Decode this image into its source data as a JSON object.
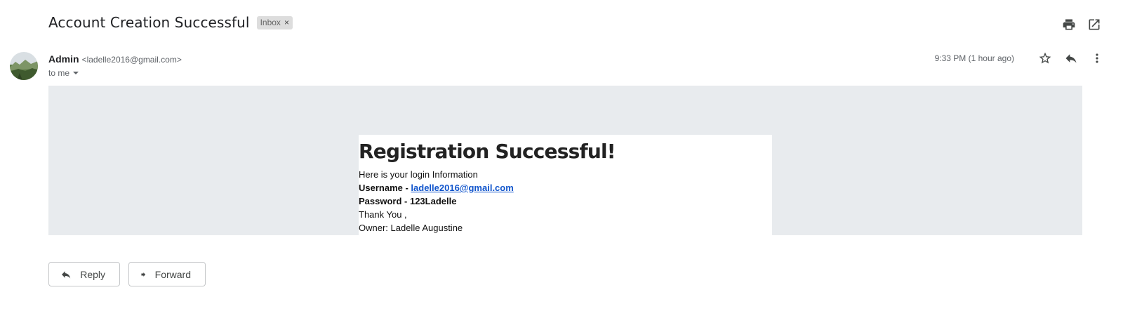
{
  "message": {
    "subject": "Account Creation Successful",
    "label_chip": "Inbox",
    "label_chip_close": "×",
    "sender_name": "Admin",
    "sender_email": "<ladelle2016@gmail.com>",
    "recipient": "to me",
    "timestamp": "9:33 PM (1 hour ago)"
  },
  "toolbar": {
    "icons": [
      "print-icon",
      "open-in-new-window-icon",
      "star-icon",
      "reply-icon",
      "more-vert-icon"
    ]
  },
  "body": {
    "heading": "Registration Successful!",
    "intro": "Here is your login Information",
    "username_label": "Username - ",
    "username_value": "ladelle2016@gmail.com",
    "password_line": "Password - 123Ladelle",
    "thanks": "Thank You ,",
    "owner": "Owner: Ladelle Augustine",
    "background_color": "#e8ebee",
    "link_color": "#1155cc"
  },
  "actions": {
    "reply_label": "Reply",
    "forward_label": "Forward"
  }
}
